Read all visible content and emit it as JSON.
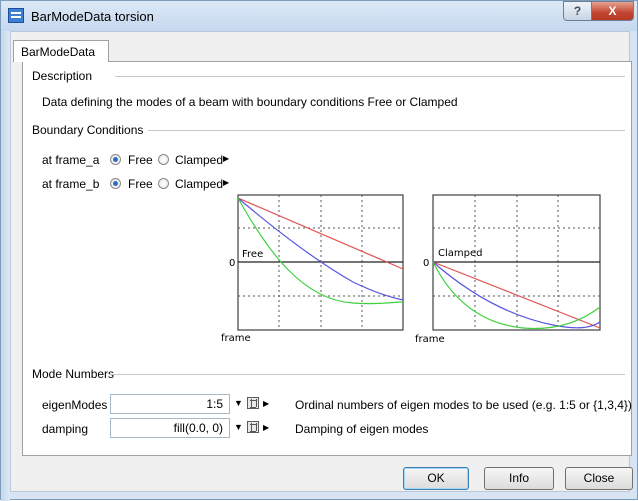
{
  "window": {
    "title": "BarModeData torsion",
    "help_label": "?",
    "close_label": "X"
  },
  "tab": {
    "label": "BarModeData"
  },
  "description": {
    "title": "Description",
    "text": "Data defining the modes of a beam with boundary conditions Free or Clamped"
  },
  "boundary": {
    "title": "Boundary Conditions",
    "rows": [
      {
        "label": "at frame_a",
        "options": [
          "Free",
          "Clamped"
        ],
        "selected": "Free"
      },
      {
        "label": "at frame_b",
        "options": [
          "Free",
          "Clamped"
        ],
        "selected": "Free"
      }
    ]
  },
  "diagrams": [
    {
      "label": "Free",
      "zero": "0",
      "axis_label": "frame"
    },
    {
      "label": "Clamped",
      "zero": "0",
      "axis_label": "frame"
    }
  ],
  "colors": {
    "red": "#e05050",
    "blue": "#5555e0",
    "green": "#40d040"
  },
  "modes": {
    "title": "Mode Numbers",
    "rows": [
      {
        "label": "eigenModes",
        "value": "1:5",
        "description": "Ordinal numbers of eigen modes to be used (e.g. 1:5 or {1,3,4})"
      },
      {
        "label": "damping",
        "value": "fill(0.0, 0)",
        "description": "Damping of eigen modes"
      }
    ]
  },
  "buttons": {
    "ok": "OK",
    "info": "Info",
    "close": "Close"
  }
}
